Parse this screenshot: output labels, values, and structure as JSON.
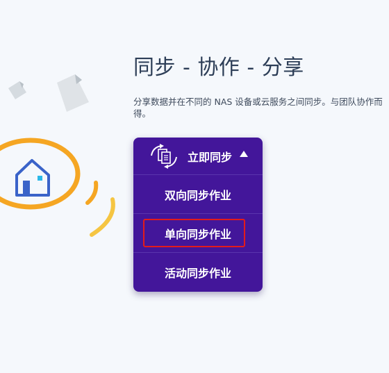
{
  "heading": "同步 - 协作 - 分享",
  "description": "分享数据并在不同的 NAS 设备或云服务之间同步。与团队协作而得。",
  "sync_menu": {
    "trigger_label": "立即同步",
    "items": [
      {
        "label": "双向同步作业"
      },
      {
        "label": "单向同步作业"
      },
      {
        "label": "活动同步作业"
      }
    ],
    "highlighted_item": "单向同步作业"
  },
  "colors": {
    "menu_bg": "#43169a",
    "highlight": "#e31b1b",
    "ring": "#f5a623",
    "house": "#3a63c9"
  },
  "icons": [
    "house-icon",
    "document-icon",
    "sync-files-icon",
    "caret-up-icon",
    "signal-waves-icon"
  ]
}
